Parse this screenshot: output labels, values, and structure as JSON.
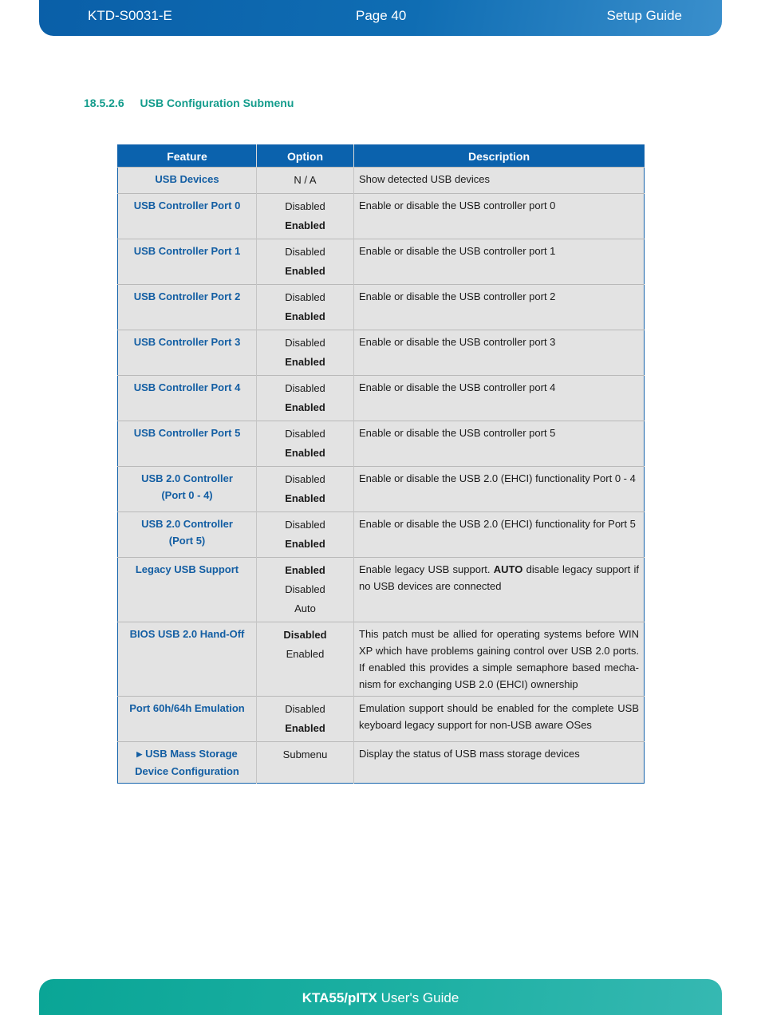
{
  "header": {
    "doc_id": "KTD-S0031-E",
    "page": "Page 40",
    "section": "Setup Guide"
  },
  "section_heading": {
    "number": "18.5.2.6",
    "title": "USB Configuration Submenu"
  },
  "table": {
    "columns": [
      "Feature",
      "Option",
      "Description"
    ],
    "rows": [
      {
        "feature": "USB Devices",
        "options": [
          {
            "label": "N / A",
            "default": false
          }
        ],
        "description": "Show detected USB devices"
      },
      {
        "feature": "USB Controller Port 0",
        "options": [
          {
            "label": "Disabled",
            "default": false
          },
          {
            "label": "Enabled",
            "default": true
          }
        ],
        "description": "Enable or disable the USB controller port 0"
      },
      {
        "feature": "USB Controller Port 1",
        "options": [
          {
            "label": "Disabled",
            "default": false
          },
          {
            "label": "Enabled",
            "default": true
          }
        ],
        "description": "Enable or disable the USB controller port 1"
      },
      {
        "feature": "USB Controller Port 2",
        "options": [
          {
            "label": "Disabled",
            "default": false
          },
          {
            "label": "Enabled",
            "default": true
          }
        ],
        "description": "Enable or disable the USB controller port 2"
      },
      {
        "feature": "USB Controller Port 3",
        "options": [
          {
            "label": "Disabled",
            "default": false
          },
          {
            "label": "Enabled",
            "default": true
          }
        ],
        "description": "Enable or disable the USB controller port 3"
      },
      {
        "feature": "USB Controller Port 4",
        "options": [
          {
            "label": "Disabled",
            "default": false
          },
          {
            "label": "Enabled",
            "default": true
          }
        ],
        "description": "Enable or disable the USB controller port 4"
      },
      {
        "feature": "USB Controller Port 5",
        "options": [
          {
            "label": "Disabled",
            "default": false
          },
          {
            "label": "Enabled",
            "default": true
          }
        ],
        "description": "Enable or disable the USB controller port 5"
      },
      {
        "feature": "USB 2.0 Controller",
        "feature_line2": "(Port 0 - 4)",
        "options": [
          {
            "label": "Disabled",
            "default": false
          },
          {
            "label": "Enabled",
            "default": true
          }
        ],
        "description": "Enable or disable the USB 2.0 (EHCI) functionality Port 0 - 4"
      },
      {
        "feature": "USB 2.0 Controller",
        "feature_line2": "(Port 5)",
        "options": [
          {
            "label": "Disabled",
            "default": false
          },
          {
            "label": "Enabled",
            "default": true
          }
        ],
        "description": "Enable or disable the USB 2.0 (EHCI) functionality for Port 5"
      },
      {
        "feature": "Legacy USB Support",
        "options": [
          {
            "label": "Enabled",
            "default": true
          },
          {
            "label": "Disabled",
            "default": false
          },
          {
            "label": "Auto",
            "default": false
          }
        ],
        "description_pre": "Enable legacy USB support. ",
        "description_bold": "AUTO",
        "description_post": " disable legacy support if no USB devices are connected"
      },
      {
        "feature": "BIOS USB 2.0 Hand-Off",
        "options": [
          {
            "label": "Disabled",
            "default": true
          },
          {
            "label": "Enabled",
            "default": false
          }
        ],
        "description": "This patch must be allied for operating systems before WIN XP which have problems gaining control over USB 2.0 ports. If enabled this provides a simple semaphore based mecha-nism for exchanging USB 2.0 (EHCI) ownership"
      },
      {
        "feature": "Port 60h/64h Emulation",
        "options": [
          {
            "label": "Disabled",
            "default": false
          },
          {
            "label": "Enabled",
            "default": true
          }
        ],
        "description": "Emulation support should be enabled for the complete USB keyboard legacy support for non-USB aware OSes"
      },
      {
        "feature": "USB Mass Storage",
        "feature_line2": "Device Configuration",
        "submenu_icon": "triangle-right",
        "options": [
          {
            "label": "Submenu",
            "default": false
          }
        ],
        "description": "Display the status of USB mass storage devices"
      }
    ]
  },
  "footer": {
    "product": "KTA55/pITX",
    "title": "User's Guide"
  }
}
